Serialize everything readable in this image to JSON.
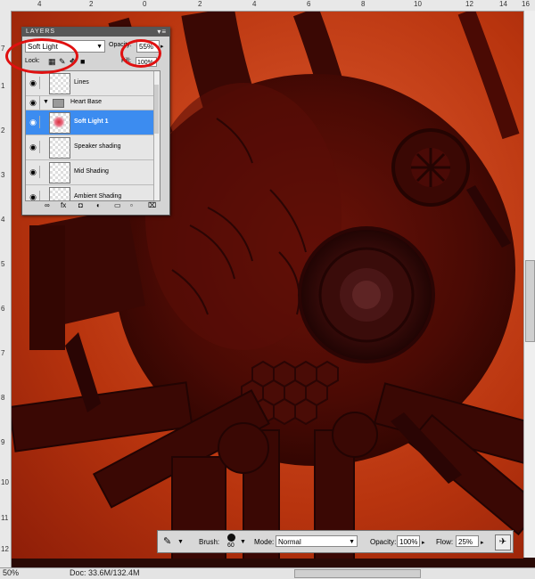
{
  "rulers": {
    "top_labels": [
      "4",
      "2",
      "0",
      "2",
      "4",
      "6",
      "8",
      "10",
      "12",
      "14",
      "16"
    ],
    "left_labels": [
      "7",
      "1",
      "2",
      "3",
      "4",
      "5",
      "6",
      "7",
      "8",
      "9",
      "10",
      "11",
      "12"
    ]
  },
  "layers_panel": {
    "title": "LAYERS",
    "blend_mode": "Soft Light",
    "opacity_label": "Opacity:",
    "opacity_value": "55%",
    "lock_label": "Lock:",
    "fill_label": "Fill:",
    "fill_value": "100%",
    "layers": [
      {
        "name": "Lines"
      },
      {
        "name": "Heart Base"
      },
      {
        "name": "Soft Light 1"
      },
      {
        "name": "Speaker shading"
      },
      {
        "name": "Mid Shading"
      },
      {
        "name": "Ambient Shading"
      }
    ]
  },
  "options_bar": {
    "brush_label": "Brush:",
    "brush_size": "60",
    "mode_label": "Mode:",
    "mode_value": "Normal",
    "opacity_label": "Opacity:",
    "opacity_value": "100%",
    "flow_label": "Flow:",
    "flow_value": "25%"
  },
  "status_bar": {
    "zoom": "50%",
    "doc": "Doc: 33.6M/132.4M"
  },
  "colors": {
    "highlight_circle": "#e01010",
    "active_layer": "#3c8cf0",
    "canvas_bg": "#c8441c"
  }
}
